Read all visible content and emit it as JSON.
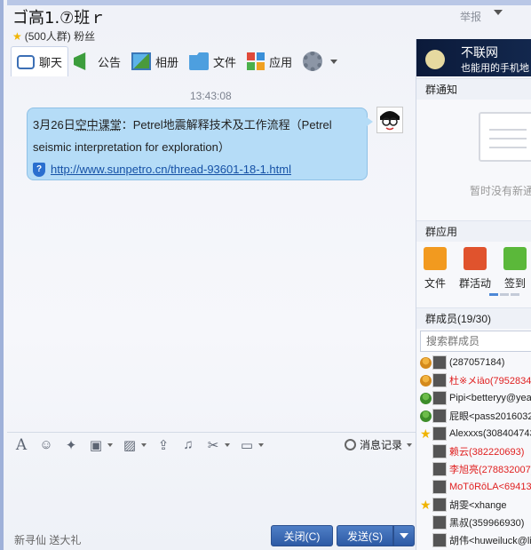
{
  "header": {
    "group_name": "ゴ高1.⑦班ｒ",
    "group_meta": "(500人群) 粉丝",
    "report_label": "举报",
    "close_glyph": "✕"
  },
  "tabs": [
    {
      "label": "聊天",
      "icon": "chat-icon"
    },
    {
      "label": "公告",
      "icon": "notice-icon"
    },
    {
      "label": "相册",
      "icon": "album-icon"
    },
    {
      "label": "文件",
      "icon": "file-icon"
    },
    {
      "label": "应用",
      "icon": "app-icon"
    }
  ],
  "chat": {
    "timestamp": "13:43:08",
    "message_prefix": "3月26日",
    "message_keyword": "空中课堂",
    "message_rest": "：Petrel地震解释技术及工作流程（Petrel seismic interpretation for exploration）",
    "link": "http://www.sunpetro.cn/thread-93601-18-1.html"
  },
  "toolbar": {
    "history_label": "消息记录"
  },
  "footer": {
    "hint": "新寻仙 送大礼",
    "close_label": "关闭(C)",
    "send_label": "发送(S)"
  },
  "right_panel": {
    "banner_title": "不联网",
    "banner_sub": "也能用的手机地",
    "notice_header": "群通知",
    "notice_empty": "暂时没有新通",
    "apps_header": "群应用",
    "apps": [
      {
        "label": "文件",
        "color": "#f29a1f"
      },
      {
        "label": "群活动",
        "color": "#e0532d"
      },
      {
        "label": "签到",
        "color": "#5bb83a"
      }
    ],
    "members_header": "群成员(19/30)",
    "search_placeholder": "搜索群成员",
    "members": [
      {
        "name": "(287057184)",
        "role": "owner",
        "red": false
      },
      {
        "name": "杜※メiāo(7952834",
        "role": "owner",
        "red": true
      },
      {
        "name": "Pipi<betteryy@yea",
        "role": "admin",
        "red": false
      },
      {
        "name": "屁眼<pass2016032",
        "role": "admin",
        "red": false
      },
      {
        "name": "Alexxxs(308404743",
        "role": "star",
        "red": false
      },
      {
        "name": "赖云(382220693)",
        "role": "none",
        "red": true
      },
      {
        "name": "李旭亮(278832007)",
        "role": "none",
        "red": true
      },
      {
        "name": "MoTōRōLA<69413",
        "role": "none",
        "red": true
      },
      {
        "name": "胡雯<xhange",
        "role": "star",
        "red": false
      },
      {
        "name": "黑叔(359966930)",
        "role": "none",
        "red": false
      },
      {
        "name": "胡伟<huweiluck@liv",
        "role": "none",
        "red": false
      }
    ]
  }
}
